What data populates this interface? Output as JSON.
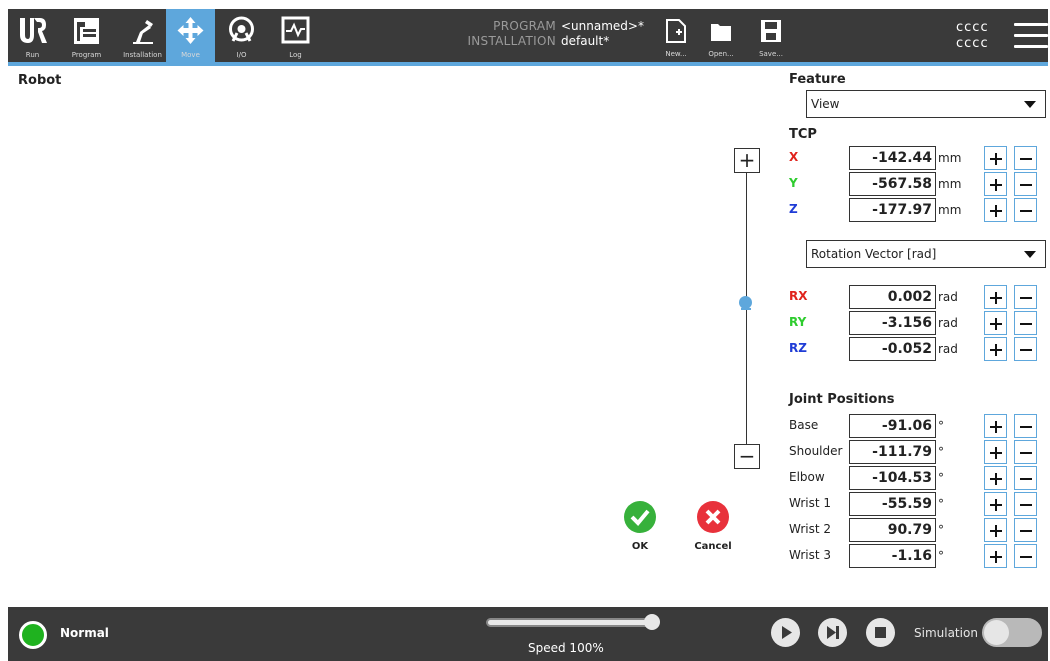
{
  "nav": [
    {
      "label": "Run",
      "icon": "ur-logo-icon"
    },
    {
      "label": "Program",
      "icon": "program-icon"
    },
    {
      "label": "Installation",
      "icon": "installation-icon"
    },
    {
      "label": "Move",
      "icon": "move-icon",
      "active": true
    },
    {
      "label": "I/O",
      "icon": "io-icon"
    },
    {
      "label": "Log",
      "icon": "log-icon"
    }
  ],
  "program": {
    "key": "PROGRAM",
    "value": "<unnamed>*"
  },
  "installation": {
    "key": "INSTALLATION",
    "value": "default*"
  },
  "file": {
    "new": "New...",
    "open": "Open...",
    "save": "Save..."
  },
  "user": {
    "line1": "cccc",
    "line2": "cccc"
  },
  "robot_title": "Robot",
  "actions": {
    "ok": "OK",
    "cancel": "Cancel"
  },
  "feature": {
    "title": "Feature",
    "selected": "View"
  },
  "tcp": {
    "title": "TCP",
    "rows": [
      {
        "label": "X",
        "value": "-142.44",
        "unit": "mm",
        "color": "#e0231c"
      },
      {
        "label": "Y",
        "value": "-567.58",
        "unit": "mm",
        "color": "#2ecc2e"
      },
      {
        "label": "Z",
        "value": "-177.97",
        "unit": "mm",
        "color": "#1f3cd6"
      }
    ],
    "rotation_mode": "Rotation Vector [rad]",
    "rot_rows": [
      {
        "label": "RX",
        "value": "0.002",
        "unit": "rad",
        "color": "#e0231c"
      },
      {
        "label": "RY",
        "value": "-3.156",
        "unit": "rad",
        "color": "#2ecc2e"
      },
      {
        "label": "RZ",
        "value": "-0.052",
        "unit": "rad",
        "color": "#1f3cd6"
      }
    ]
  },
  "joints": {
    "title": "Joint Positions",
    "rows": [
      {
        "label": "Base",
        "value": "-91.06",
        "unit": "°"
      },
      {
        "label": "Shoulder",
        "value": "-111.79",
        "unit": "°"
      },
      {
        "label": "Elbow",
        "value": "-104.53",
        "unit": "°"
      },
      {
        "label": "Wrist 1",
        "value": "-55.59",
        "unit": "°"
      },
      {
        "label": "Wrist 2",
        "value": "90.79",
        "unit": "°"
      },
      {
        "label": "Wrist 3",
        "value": "-1.16",
        "unit": "°"
      }
    ]
  },
  "status": {
    "label": "Normal",
    "color": "#1fb21f"
  },
  "speed": {
    "label": "Speed 100%",
    "percent": 100
  },
  "simulation": {
    "label": "Simulation",
    "on": false
  }
}
